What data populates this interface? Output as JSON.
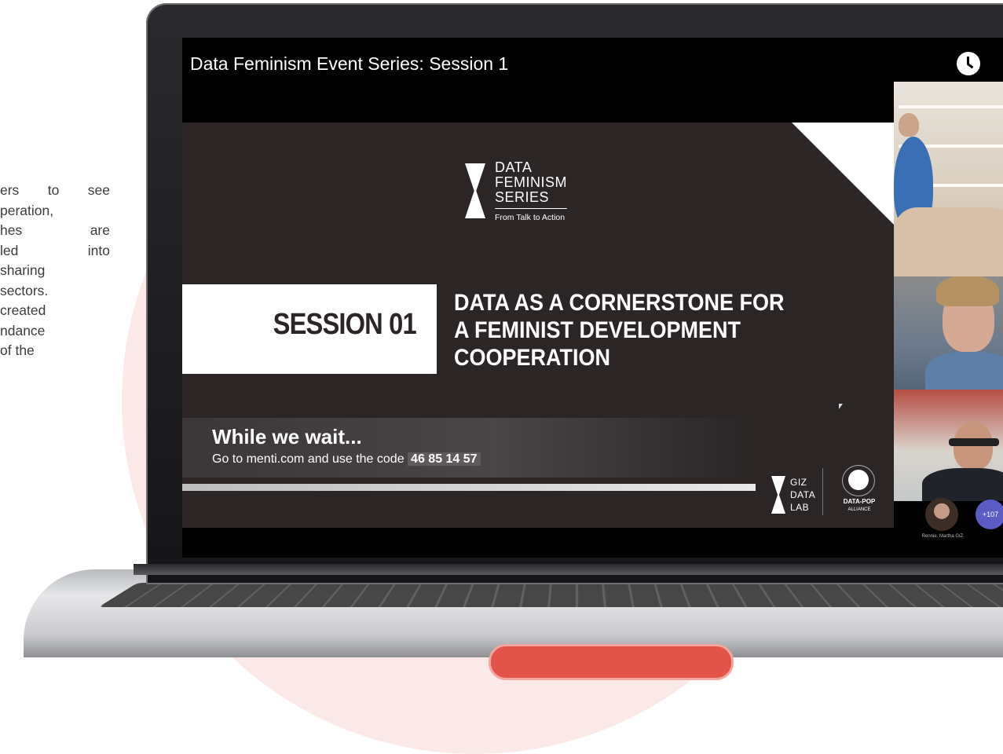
{
  "side_text": [
    "ers to see",
    "peration,",
    "hes are",
    "led into",
    "sharing",
    "sectors.",
    "created",
    "ndance",
    "of the"
  ],
  "video": {
    "title": "Data Feminism Event Series: Session 1"
  },
  "slide": {
    "logo_lines": [
      "DATA",
      "FEMINISM",
      "SERIES"
    ],
    "logo_tagline": "From Talk to Action",
    "session_label": "SESSION 01",
    "session_title": "DATA AS A CORNERSTONE FOR\nA FEMINIST DEVELOPMENT\nCOOPERATION",
    "wait_heading": "While we wait...",
    "wait_instruction": "Go to menti.com and use the code",
    "wait_code": "46 85 14 57",
    "giz_logo_lines": [
      "GIZ",
      "DATA",
      "LAB"
    ],
    "dpa_logo": "DATA-POP",
    "dpa_logo_sub": "ALLIANCE"
  },
  "participants": {
    "avatar_name": "Rennie, Martha GIZ",
    "more_count": "+107"
  },
  "colors": {
    "slide_bg": "#2b2526",
    "accent_red": "#e2534a",
    "bg_circle": "#fbe9e7"
  }
}
